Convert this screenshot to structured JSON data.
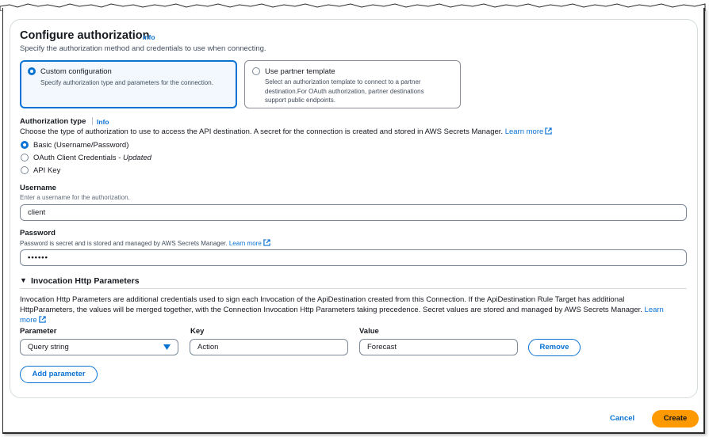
{
  "section": {
    "title": "Configure authorization",
    "info": "Info",
    "description": "Specify the authorization method and credentials to use when connecting."
  },
  "tiles": [
    {
      "title": "Custom configuration",
      "description": "Specify authorization type and parameters for the connection.",
      "selected": true
    },
    {
      "title": "Use partner template",
      "description_lines": [
        "Select an authorization template to connect to a partner",
        "destination.For OAuth authorization, partner destinations",
        "support public endpoints."
      ],
      "selected": false
    }
  ],
  "auth_type": {
    "label": "Authorization type",
    "info": "Info",
    "description": "Choose the type of authorization to use to access the API destination. A secret for the connection is created and stored in AWS Secrets Manager.",
    "learn_more": "Learn more",
    "options": [
      {
        "label": "Basic (Username/Password)",
        "selected": true
      },
      {
        "label": "OAuth Client Credentials - ",
        "suffix": "Updated",
        "selected": false
      },
      {
        "label": "API Key",
        "selected": false
      }
    ]
  },
  "username": {
    "label": "Username",
    "hint": "Enter a username for the authorization.",
    "value": "client"
  },
  "password": {
    "label": "Password",
    "hint": "Password is secret and is stored and managed by AWS Secrets Manager.",
    "learn_more": "Learn more",
    "value": "••••••"
  },
  "invocation": {
    "toggle": "▼",
    "title": "Invocation Http Parameters",
    "description_line1": "Invocation Http Parameters are additional credentials used to sign each Invocation of the ApiDestination created from this Connection. If the ApiDestination Rule Target has additional",
    "description_line2": "HttpParameters, the values will be merged together, with the Connection Invocation Http Parameters taking precedence. Secret values are stored and managed by AWS Secrets Manager.",
    "learn": "Learn",
    "more": "more",
    "columns": {
      "parameter": "Parameter",
      "key": "Key",
      "value": "Value"
    },
    "row": {
      "parameter": "Query string",
      "key": "Action",
      "value": "Forecast",
      "remove": "Remove"
    },
    "add": "Add parameter"
  },
  "footer": {
    "cancel": "Cancel",
    "create": "Create"
  },
  "colors": {
    "accent": "#0972d3",
    "primary": "#ff9900"
  }
}
